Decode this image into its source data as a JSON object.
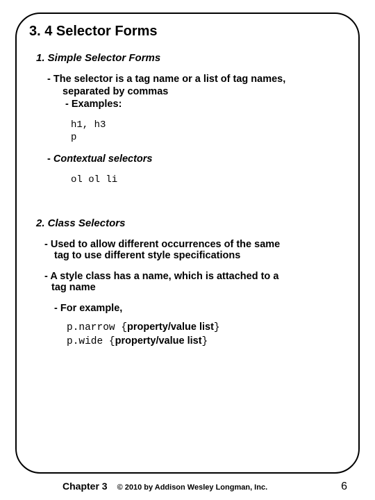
{
  "title": "3. 4 Selector Forms",
  "sec1": {
    "heading": "1. Simple Selector Forms",
    "b1_l1": "- The selector is a tag name or a list of tag names,",
    "b1_l2": "separated by commas",
    "b2": "- Examples:",
    "code": "h1, h3\np",
    "ctx_dash": "- ",
    "ctx_text": "Contextual selectors",
    "code2": "ol ol li"
  },
  "sec2": {
    "heading": "2. Class Selectors",
    "b1_l1": "- Used to allow different occurrences of the same",
    "b1_l2": "tag to use different style specifications",
    "b2_l1": "- A style class has a name, which is attached to a",
    "b2_l2": "tag name",
    "b3": "- For example,",
    "ex1_mono": "p.narrow {",
    "ex1_text": "property/value list",
    "ex1_close": "}",
    "ex2_mono": "p.wide {",
    "ex2_text": "property/value list",
    "ex2_close": "}"
  },
  "footer": {
    "chapter": "Chapter 3",
    "copyright": "© 2010 by Addison Wesley Longman, Inc.",
    "page": "6"
  }
}
